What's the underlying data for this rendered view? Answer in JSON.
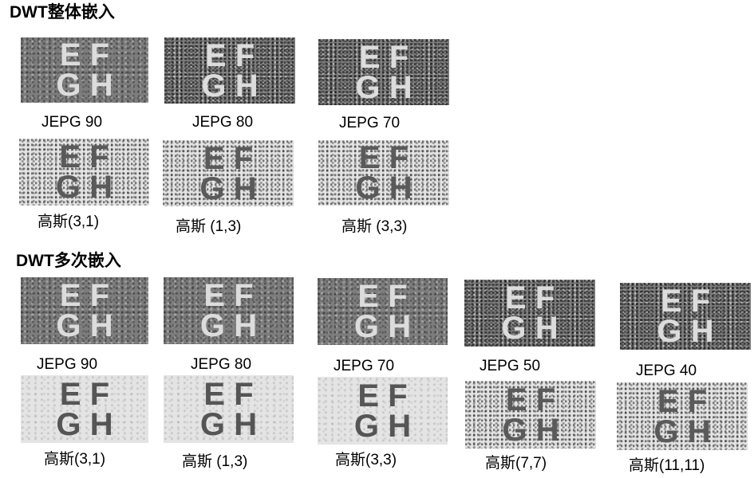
{
  "sections": [
    {
      "title": "DWT整体嵌入",
      "rows": [
        [
          {
            "glyph": "EF\nGH",
            "caption": "JEPG 90"
          },
          {
            "glyph": "EF\nGH",
            "caption": "JEPG 80"
          },
          {
            "glyph": "EF\nGH",
            "caption": "JEPG 70"
          }
        ],
        [
          {
            "glyph": "EF\nGH",
            "caption": "高斯(3,1)"
          },
          {
            "glyph": "EF\nGH",
            "caption": "高斯 (1,3)"
          },
          {
            "glyph": "EF\nGH",
            "caption": "高斯 (3,3)"
          }
        ]
      ]
    },
    {
      "title": "DWT多次嵌入",
      "rows": [
        [
          {
            "glyph": "EF\nGH",
            "caption": "JEPG 90"
          },
          {
            "glyph": "EF\nGH",
            "caption": "JEPG 80"
          },
          {
            "glyph": "EF\nGH",
            "caption": "JEPG 70"
          },
          {
            "glyph": "EF\nGH",
            "caption": "JEPG 50"
          },
          {
            "glyph": "EF\nGH",
            "caption": "JEPG 40"
          }
        ],
        [
          {
            "glyph": "EF\nGH",
            "caption": "高斯(3,1)"
          },
          {
            "glyph": "EF\nGH",
            "caption": "高斯 (1,3)"
          },
          {
            "glyph": "EF\nGH",
            "caption": "高斯(3,3)"
          },
          {
            "glyph": "EF\nGH",
            "caption": "高斯(7,7)"
          },
          {
            "glyph": "EF\nGH",
            "caption": "高斯(11,11)"
          }
        ]
      ]
    }
  ]
}
